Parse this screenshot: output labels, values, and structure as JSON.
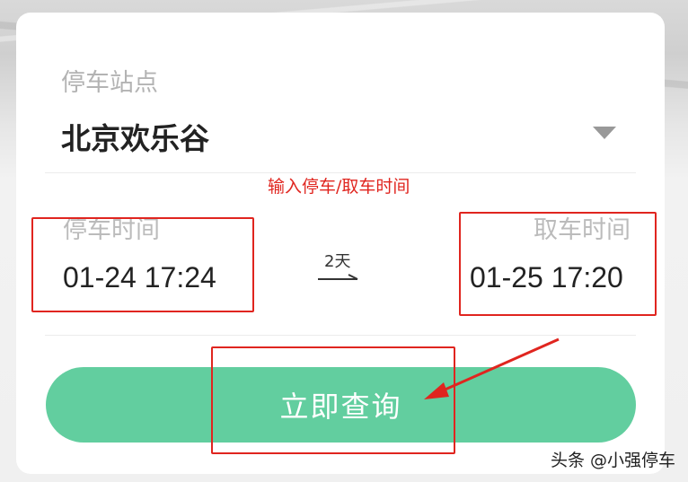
{
  "form": {
    "station_label": "停车站点",
    "station_value": "北京欢乐谷",
    "parking_time_label": "停车时间",
    "parking_time_value": "01-24 17:24",
    "pickup_time_label": "取车时间",
    "pickup_time_value": "01-25 17:20",
    "duration": "2天",
    "search_button": "立即查询"
  },
  "annotation": {
    "text": "输入停车/取车时间",
    "color": "#e0251f"
  },
  "watermark": "头条 @小强停车",
  "colors": {
    "button": "#62ce9f",
    "annotation_red": "#e0251f"
  },
  "icons": {
    "dropdown": "chevron-down-icon",
    "duration_arrow": "arrow-right-icon"
  }
}
